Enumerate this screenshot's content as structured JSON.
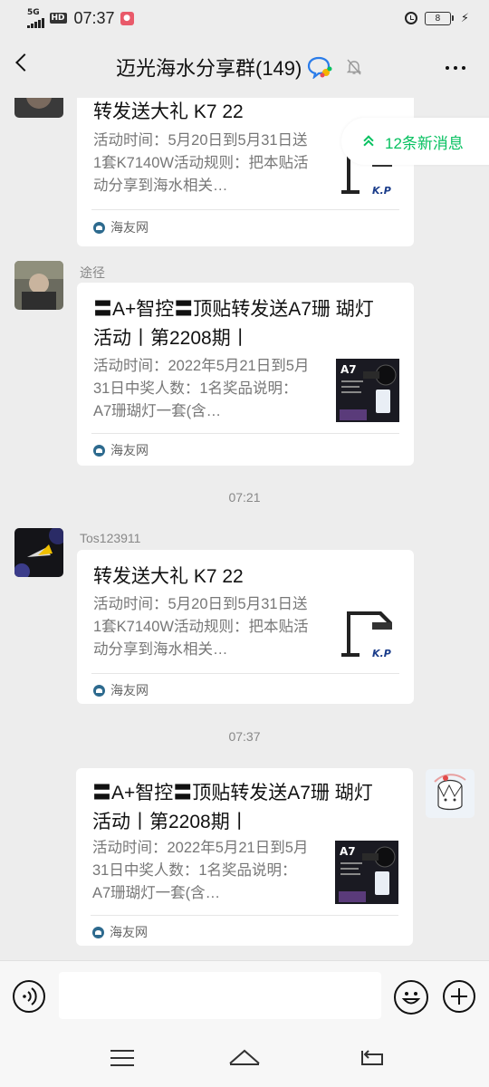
{
  "status_bar": {
    "network": "5G",
    "hd": "HD",
    "time": "07:37",
    "battery": "8"
  },
  "header": {
    "title": "迈光海水分享群(149)"
  },
  "new_messages": {
    "label": "12条新消息"
  },
  "messages": [
    {
      "sender": "",
      "title": "转发送大礼 K7 22",
      "desc": "活动时间：5月20日到5月31日送1套K7140W活动规则：把本贴活动分享到海水相关…",
      "source": "海友网"
    },
    {
      "sender": "途径",
      "title": "〓A+智控〓顶贴转发送A7珊 瑚灯活动丨第2208期丨",
      "desc": "活动时间：2022年5月21日到5月31日中奖人数：1名奖品说明：A7珊瑚灯一套(含…",
      "source": "海友网"
    },
    {
      "timestamp": "07:21"
    },
    {
      "sender": "Tos123911",
      "title": "转发送大礼 K7 22",
      "desc": "活动时间：5月20日到5月31日送1套K7140W活动规则：把本贴活动分享到海水相关…",
      "source": "海友网"
    },
    {
      "timestamp": "07:37"
    },
    {
      "sender": "",
      "title": "〓A+智控〓顶贴转发送A7珊 瑚灯活动丨第2208期丨",
      "desc": "活动时间：2022年5月21日到5月31日中奖人数：1名奖品说明：A7珊瑚灯一套(含…",
      "source": "海友网"
    }
  ],
  "input": {
    "value": "",
    "placeholder": ""
  },
  "thumbs": {
    "k7_logo": "K.P",
    "a7_label": "A7"
  },
  "colors": {
    "accent": "#07c160",
    "background": "#ededed"
  }
}
